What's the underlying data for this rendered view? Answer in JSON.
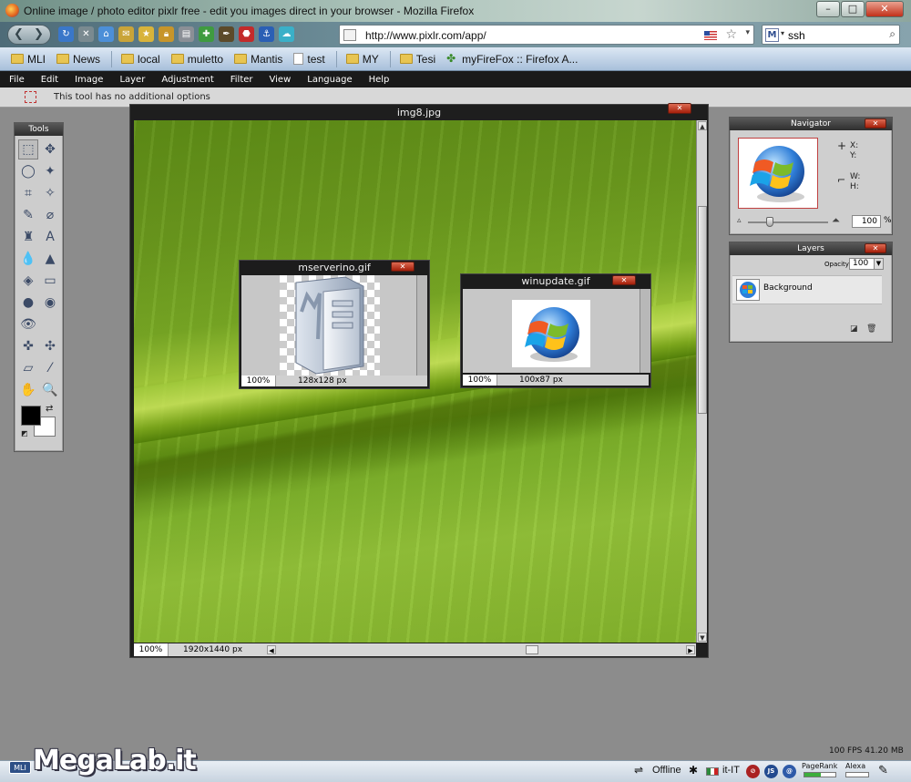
{
  "window": {
    "title": "Online image / photo editor pixlr free - edit you images direct in your browser - Mozilla Firefox",
    "minimize": "–",
    "maximize": "□",
    "close": "✕"
  },
  "navbar": {
    "url": "http://www.pixlr.com/app/",
    "search_value": "ssh",
    "search_engine_icon": "M"
  },
  "bookmarks": [
    {
      "label": "MLI",
      "icon": "folder"
    },
    {
      "label": "News",
      "icon": "folder"
    },
    {
      "label": "local",
      "icon": "folder"
    },
    {
      "label": "muletto",
      "icon": "folder"
    },
    {
      "label": "Mantis",
      "icon": "folder"
    },
    {
      "label": "test",
      "icon": "page"
    },
    {
      "label": "MY",
      "icon": "folder"
    },
    {
      "label": "Tesi",
      "icon": "folder"
    },
    {
      "label": "myFireFox :: Firefox A...",
      "icon": "puzzle"
    }
  ],
  "menu": [
    "File",
    "Edit",
    "Image",
    "Layer",
    "Adjustment",
    "Filter",
    "View",
    "Language",
    "Help"
  ],
  "options_bar": {
    "message": "This tool has no additional options"
  },
  "tools": {
    "title": "Tools",
    "items": [
      {
        "name": "marquee-icon",
        "glyph": "⬚",
        "active": true
      },
      {
        "name": "move-icon",
        "glyph": "✥",
        "active": false
      },
      {
        "name": "lasso-icon",
        "glyph": "◯",
        "active": false
      },
      {
        "name": "wand-icon",
        "glyph": "✦",
        "active": false
      },
      {
        "name": "crop-icon",
        "glyph": "⌗",
        "active": false
      },
      {
        "name": "magic-wand-icon",
        "glyph": "✧",
        "active": false
      },
      {
        "name": "pencil-icon",
        "glyph": "✎",
        "active": false
      },
      {
        "name": "brush-icon",
        "glyph": "⌀",
        "active": false
      },
      {
        "name": "stamp-icon",
        "glyph": "♜",
        "active": false
      },
      {
        "name": "text-icon",
        "glyph": "A",
        "active": false
      },
      {
        "name": "drop-icon",
        "glyph": "💧",
        "active": false
      },
      {
        "name": "sharpen-icon",
        "glyph": "▲",
        "active": false
      },
      {
        "name": "bucket-icon",
        "glyph": "◈",
        "active": false
      },
      {
        "name": "gradient-icon",
        "glyph": "▭",
        "active": false
      },
      {
        "name": "burn-icon",
        "glyph": "●",
        "active": false
      },
      {
        "name": "redeye-icon",
        "glyph": "◉",
        "active": false
      },
      {
        "name": "eye-icon",
        "glyph": "👁",
        "active": false
      },
      {
        "name": "empty-slot",
        "glyph": "",
        "active": false
      },
      {
        "name": "spot-heal-icon",
        "glyph": "✜",
        "active": false
      },
      {
        "name": "bloat-icon",
        "glyph": "✣",
        "active": false
      },
      {
        "name": "eraser-icon",
        "glyph": "▱",
        "active": false
      },
      {
        "name": "eyedropper-icon",
        "glyph": "⁄",
        "active": false
      },
      {
        "name": "hand-icon",
        "glyph": "✋",
        "active": false
      },
      {
        "name": "zoom-icon",
        "glyph": "🔍",
        "active": false
      }
    ],
    "foreground_color": "#000000",
    "background_color": "#ffffff"
  },
  "document": {
    "title": "img8.jpg",
    "zoom": "100%",
    "dimensions": "1920x1440 px"
  },
  "image_windows": [
    {
      "title": "mserverino.gif",
      "zoom": "100%",
      "dimensions": "128x128 px"
    },
    {
      "title": "winupdate.gif",
      "zoom": "100%",
      "dimensions": "100x87 px"
    }
  ],
  "navigator": {
    "title": "Navigator",
    "x_label": "X:",
    "y_label": "Y:",
    "w_label": "W:",
    "h_label": "H:",
    "zoom_value": "100",
    "zoom_unit": "%"
  },
  "layers": {
    "title": "Layers",
    "opacity_label": "Opacity:",
    "opacity_value": "100",
    "items": [
      {
        "name": "Background"
      }
    ]
  },
  "fps_info": "100 FPS 41.20 MB",
  "statusbar": {
    "logo": "MegaLab.it",
    "logo_badge": "MLI",
    "offline": "Offline",
    "locale": "it-IT",
    "js": "JS",
    "pagerank": "PageRank",
    "alexa": "Alexa"
  }
}
